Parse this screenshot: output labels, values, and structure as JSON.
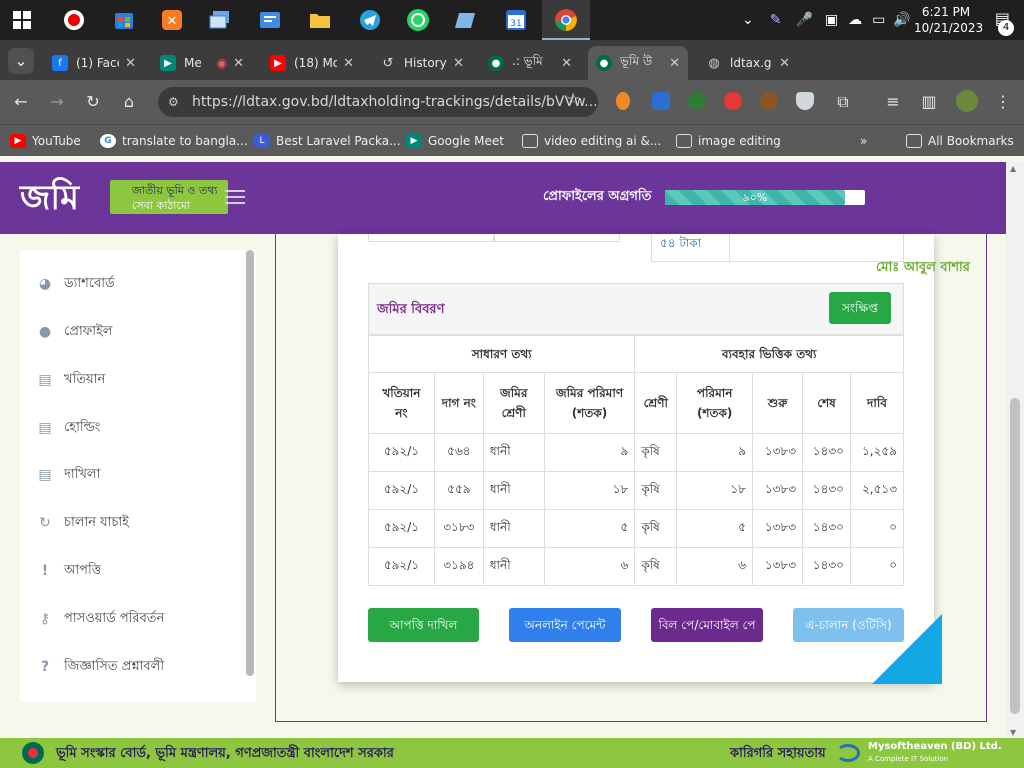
{
  "taskbar": {
    "clock_time": "6:21 PM",
    "clock_date": "10/21/2023",
    "notification_count": "4",
    "calendar_day": "31"
  },
  "browser": {
    "tabs": [
      {
        "label": "(1) Face",
        "favicon": "facebook-icon",
        "color": "#1877f2"
      },
      {
        "label": "Me",
        "favicon": "meet-icon",
        "color": "#00897b"
      },
      {
        "label": "(18) Mo",
        "favicon": "youtube-icon",
        "color": "#ff0000"
      },
      {
        "label": "History",
        "favicon": "history-icon",
        "color": "#5a5a5a"
      },
      {
        "label": ".: ভূমি",
        "favicon": "bd-emblem-icon",
        "color": "#006a4e"
      },
      {
        "label": "ভূমি উ",
        "favicon": "bd-emblem-icon",
        "color": "#006a4e"
      },
      {
        "label": "ldtax.g",
        "favicon": "globe-icon",
        "color": "#5a5a5a"
      }
    ],
    "url": "https://ldtax.gov.bd/ldtaxholding-trackings/details/bVVw...",
    "bookmarks": [
      {
        "label": "YouTube",
        "icon": "youtube-icon",
        "color": "#ff0000"
      },
      {
        "label": "translate to bangla...",
        "icon": "google-icon",
        "color": "#4285f4"
      },
      {
        "label": "Best Laravel Packa...",
        "icon": "laravel-icon",
        "color": "#3b5bdb"
      },
      {
        "label": "Google Meet",
        "icon": "meet-icon",
        "color": "#00897b"
      },
      {
        "label": "video editing ai &...",
        "icon": "folder-icon",
        "color": "#5a5a5a"
      },
      {
        "label": "image editing",
        "icon": "folder-icon",
        "color": "#5a5a5a"
      },
      {
        "label": "All Bookmarks",
        "icon": "folder-icon",
        "color": "#5a5a5a"
      }
    ]
  },
  "site": {
    "logo_main": "জমি",
    "logo_line1": "জাতীয় ভূমি ও তথ্য",
    "logo_line2": "সেবা কাঠামো",
    "progress_label": "প্রোফাইলের অগ্রগতি",
    "progress_value": 0.9,
    "progress_text": "৯০%",
    "owner_name": "মোঃ আবুল বাশার",
    "tax_amount": "৫৪ টাকা"
  },
  "sidebar": {
    "items": [
      {
        "label": "ড্যাশবোর্ড",
        "icon": "dashboard-icon",
        "glyph": "◕"
      },
      {
        "label": "প্রোফাইল",
        "icon": "user-icon",
        "glyph": "●"
      },
      {
        "label": "খতিয়ান",
        "icon": "book-icon",
        "glyph": "▤"
      },
      {
        "label": "হোল্ডিং",
        "icon": "book-icon",
        "glyph": "▤"
      },
      {
        "label": "দাখিলা",
        "icon": "book-icon",
        "glyph": "▤"
      },
      {
        "label": "চালান যাচাই",
        "icon": "refresh-icon",
        "glyph": "↻"
      },
      {
        "label": "আপত্তি",
        "icon": "exclamation-icon",
        "glyph": "!"
      },
      {
        "label": "পাসওয়ার্ড পরিবর্তন",
        "icon": "key-icon",
        "glyph": "⚷"
      },
      {
        "label": "জিজ্ঞাসিত প্রশ্নাবলী",
        "icon": "question-icon",
        "glyph": "?"
      }
    ]
  },
  "land_info": {
    "title": "জমির বিবরণ",
    "summary_button": "সংক্ষিপ্ত",
    "group_general": "সাধারণ তথ্য",
    "group_usage": "ব্যবহার ভিত্তিক তথ্য",
    "headers": {
      "khatian": "খতিয়ান নং",
      "dag": "দাগ নং",
      "class": "জমির শ্রেণী",
      "area": "জমির পরিমাণ (শতক)",
      "use_class": "শ্রেণী",
      "use_area": "পরিমান (শতক)",
      "start": "শুরু",
      "end": "শেষ",
      "claim": "দাবি"
    },
    "rows": [
      {
        "khatian": "৫৯২/১",
        "dag": "৫৬৪",
        "class": "ধানী",
        "area": "৯",
        "use_class": "কৃষি",
        "use_area": "৯",
        "start": "১৩৮৩",
        "end": "১৪৩০",
        "claim": "১,২৫৯"
      },
      {
        "khatian": "৫৯২/১",
        "dag": "৫৫৯",
        "class": "ধানী",
        "area": "১৮",
        "use_class": "কৃষি",
        "use_area": "১৮",
        "start": "১৩৮৩",
        "end": "১৪৩০",
        "claim": "২,৫১৩"
      },
      {
        "khatian": "৫৯২/১",
        "dag": "৩১৮৩",
        "class": "ধানী",
        "area": "৫",
        "use_class": "কৃষি",
        "use_area": "৫",
        "start": "১৩৮৩",
        "end": "১৪৩০",
        "claim": "০"
      },
      {
        "khatian": "৫৯২/১",
        "dag": "৩১৯৪",
        "class": "ধানী",
        "area": "৬",
        "use_class": "কৃষি",
        "use_area": "৬",
        "start": "১৩৮৩",
        "end": "১৪৩০",
        "claim": "০"
      }
    ]
  },
  "actions": {
    "objection": "আপত্তি দাখিল",
    "online_payment": "অনলাইন পেমেন্ট",
    "bill_pay": "বিল পে/মোবাইল পে",
    "a_challan": "এ-চালান (ওটিসি)",
    "colors": {
      "objection": "#28a745",
      "online_payment": "#2f80ed",
      "bill_pay": "#6b2a8c",
      "a_challan": "#7fc1ee"
    }
  },
  "footer": {
    "left_text": "ভূমি সংস্কার বোর্ড, ভূমি মন্ত্রণালয়, গণপ্রজাতন্ত্রী বাংলাদেশ সরকার",
    "support_text": "কারিগরি সহায়তায়",
    "company": "Mysoftheaven (BD) Ltd.",
    "tagline": "A Complete IT Solution"
  },
  "colors": {
    "brand_purple": "#6b3599",
    "brand_green": "#8dc63f",
    "teal": "#3fb4a8"
  }
}
